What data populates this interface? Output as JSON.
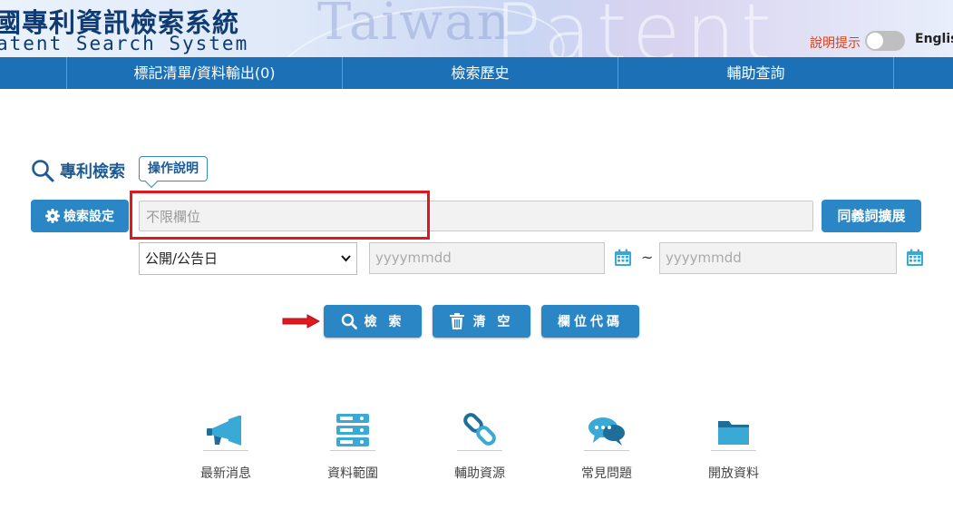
{
  "header": {
    "watermark_1": "Taiwan",
    "watermark_2": "Patent",
    "title_zh": "國專利資訊檢索系統",
    "title_en": "atent Search System",
    "help_toggle_label": "說明提示",
    "language_link": "Englis"
  },
  "nav": {
    "items": [
      "標記清單/資料輸出(0)",
      "檢索歷史",
      "輔助查詢"
    ]
  },
  "search": {
    "section_title": "專利檢索",
    "help_button": "操作說明",
    "settings_button": "檢索設定",
    "query_placeholder": "不限欄位",
    "synonym_button": "同義詞擴展",
    "date_field_selected": "公開/公告日",
    "date_from_placeholder": "yyyymmdd",
    "date_range_separator": "~",
    "date_to_placeholder": "yyyymmdd",
    "search_button": "檢 索",
    "clear_button": "清 空",
    "field_code_button": "欄位代碼"
  },
  "shortcuts": [
    {
      "label": "最新消息",
      "icon": "megaphone-icon"
    },
    {
      "label": "資料範圍",
      "icon": "server-icon"
    },
    {
      "label": "輔助資源",
      "icon": "chain-link-icon"
    },
    {
      "label": "常見問題",
      "icon": "chat-bubbles-icon"
    },
    {
      "label": "開放資料",
      "icon": "folder-icon"
    }
  ],
  "colors": {
    "primary": "#2b86c5",
    "nav": "#1c70b6",
    "highlight": "#e0191f",
    "help_text": "#d9421c",
    "icon_teal": "#3aa9d6"
  }
}
